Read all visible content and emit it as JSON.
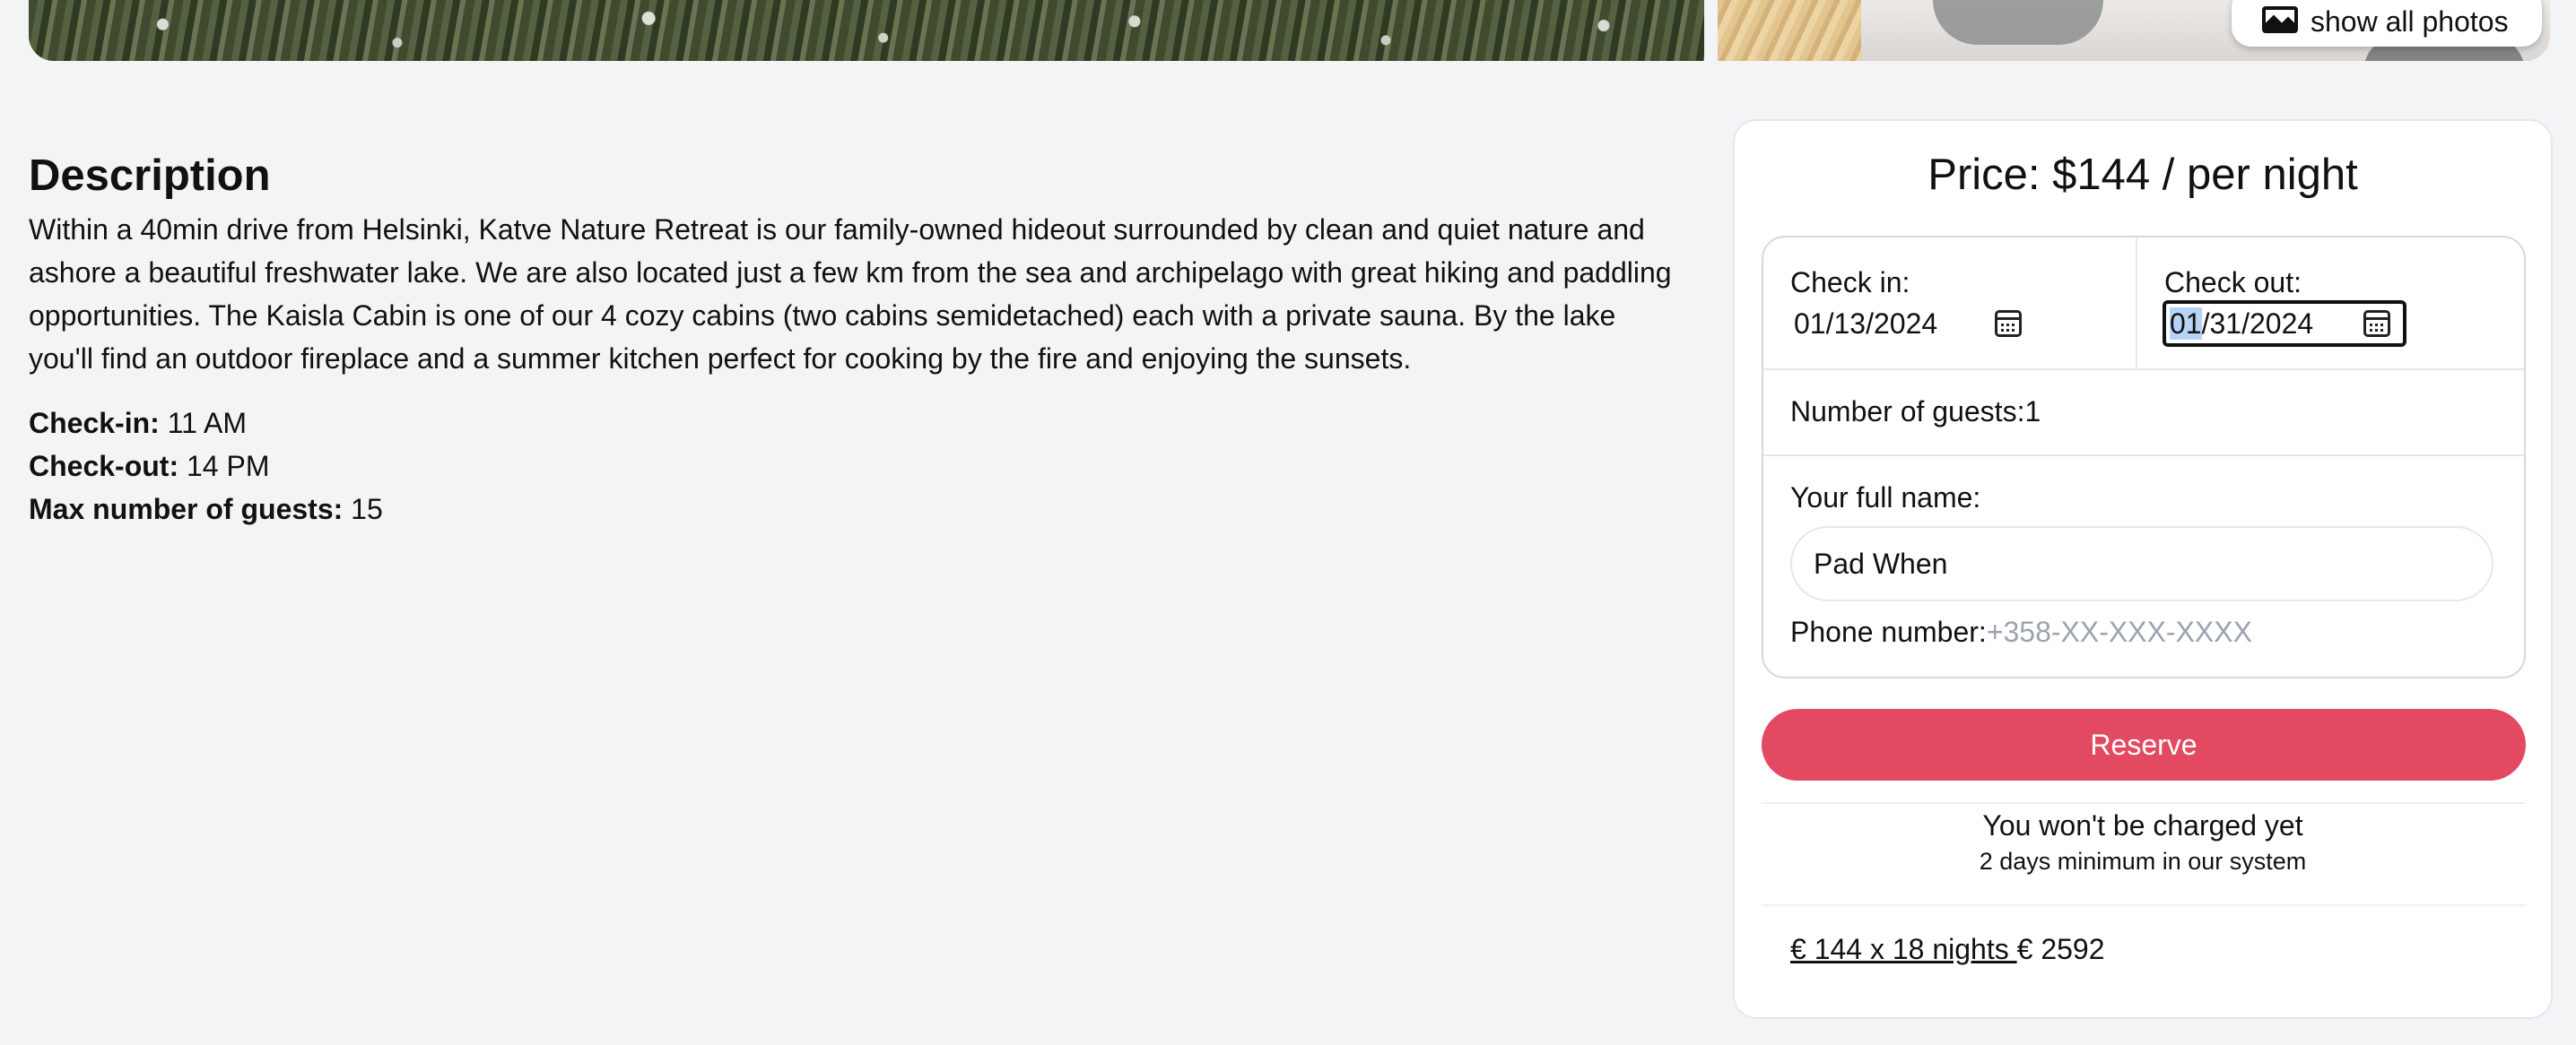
{
  "gallery": {
    "show_all_label": "show all photos"
  },
  "description": {
    "heading": "Description",
    "body": "Within a 40min drive from Helsinki, Katve Nature Retreat is our family-owned hideout surrounded by clean and quiet nature and ashore a beautiful freshwater lake. We are also located just a few km from the sea and archipelago with great hiking and paddling opportunities. The Kaisla Cabin is one of our 4 cozy cabins (two cabins semidetached) each with a private sauna. By the lake you'll find an outdoor fireplace and a summer kitchen perfect for cooking by the fire and enjoying the sunsets.",
    "details": [
      {
        "label": "Check-in:",
        "value": "11 AM"
      },
      {
        "label": "Check-out:",
        "value": "14 PM"
      },
      {
        "label": "Max number of guests:",
        "value": "15"
      }
    ]
  },
  "booking": {
    "price_label": "Price: $144 / per night",
    "check_in": {
      "label": "Check in:",
      "value": "01/13/2024"
    },
    "check_out": {
      "label": "Check out:",
      "value_selected": "01",
      "value_rest": "/31/2024"
    },
    "guests_label": "Number of guests:1",
    "name": {
      "label": "Your full name:",
      "value": "Pad When"
    },
    "phone": {
      "label": "Phone number:",
      "placeholder": "+358-XX-XXX-XXXX"
    },
    "reserve_label": "Reserve",
    "charge_note": "You won't be charged yet",
    "minimum_note": "2 days minimum in our system",
    "total": {
      "calc": "€ 144 x 18 nights ",
      "amount": "€ 2592"
    }
  },
  "colors": {
    "background": "#f3f4f6",
    "card": "#ffffff",
    "reserve_button": "#e34a61",
    "placeholder_text": "#9ca3af",
    "selection": "#b7d3f5"
  },
  "icons": [
    "image-icon",
    "calendar-icon"
  ]
}
